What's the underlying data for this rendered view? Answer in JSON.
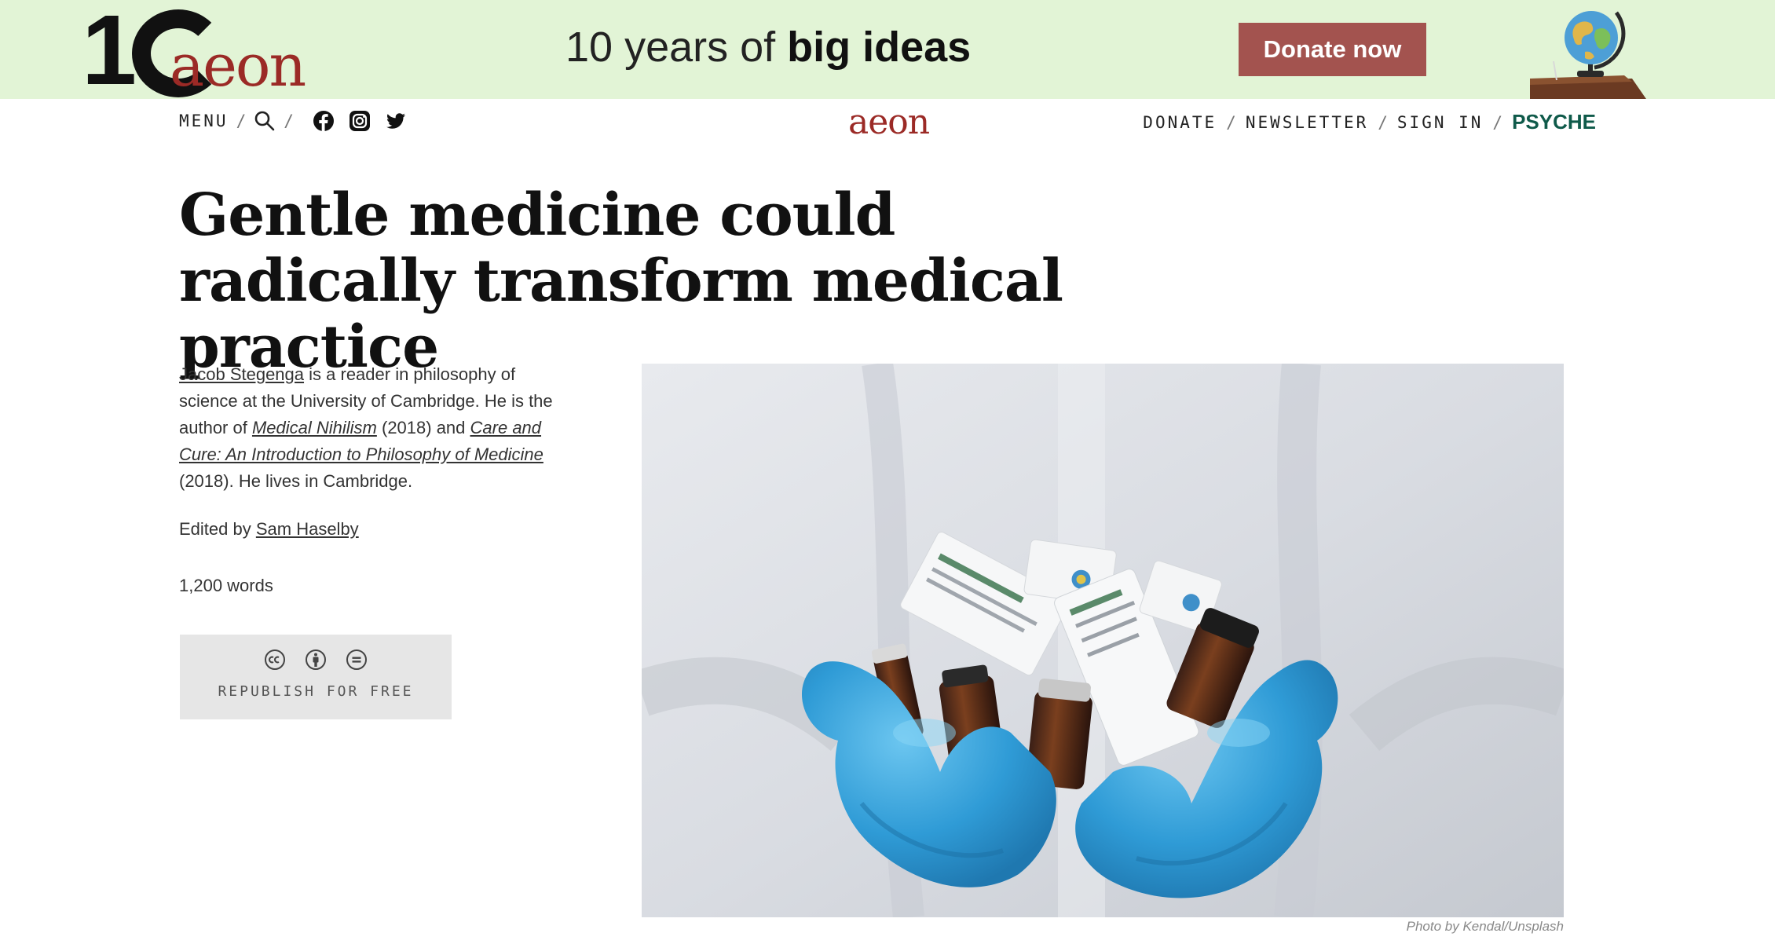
{
  "banner": {
    "logo_number": "1",
    "logo_word": "aeon",
    "text_plain": "10 years of ",
    "text_bold": "big ideas",
    "donate_label": "Donate now",
    "bg_color": "#e2f4d6",
    "donate_color": "#a3534f"
  },
  "nav": {
    "menu_label": "MENU",
    "slash": "/",
    "center_logo": "aeon",
    "donate": "DONATE",
    "newsletter": "NEWSLETTER",
    "sign_in": "SIGN IN",
    "psyche": "PSYCHE",
    "icons": [
      "search-icon",
      "facebook-icon",
      "instagram-icon",
      "twitter-icon"
    ]
  },
  "article": {
    "title": "Gentle medicine could radically transform medical practice",
    "author_name": "Jacob Stegenga",
    "bio_1": " is a reader in philosophy of science at the University of Cambridge. He is the author of ",
    "book_1": "Medical Nihilism",
    "bio_2": " (2018) and ",
    "book_2": "Care and Cure: An Introduction to Philosophy of Medicine",
    "bio_3": " (2018). He lives in Cambridge.",
    "edited_prefix": "Edited by ",
    "editor": "Sam Haselby",
    "word_count": "1,200 words",
    "republish_label": "REPUBLISH FOR FREE",
    "republish_icons": [
      "cc-icon",
      "attribution-icon",
      "no-derivatives-icon"
    ],
    "photo_credit": "Photo by Kendal/Unsplash"
  },
  "colors": {
    "aeon_red": "#9b2a26",
    "psyche_green": "#0f5a4a",
    "glove_blue": "#3aa6dc"
  }
}
